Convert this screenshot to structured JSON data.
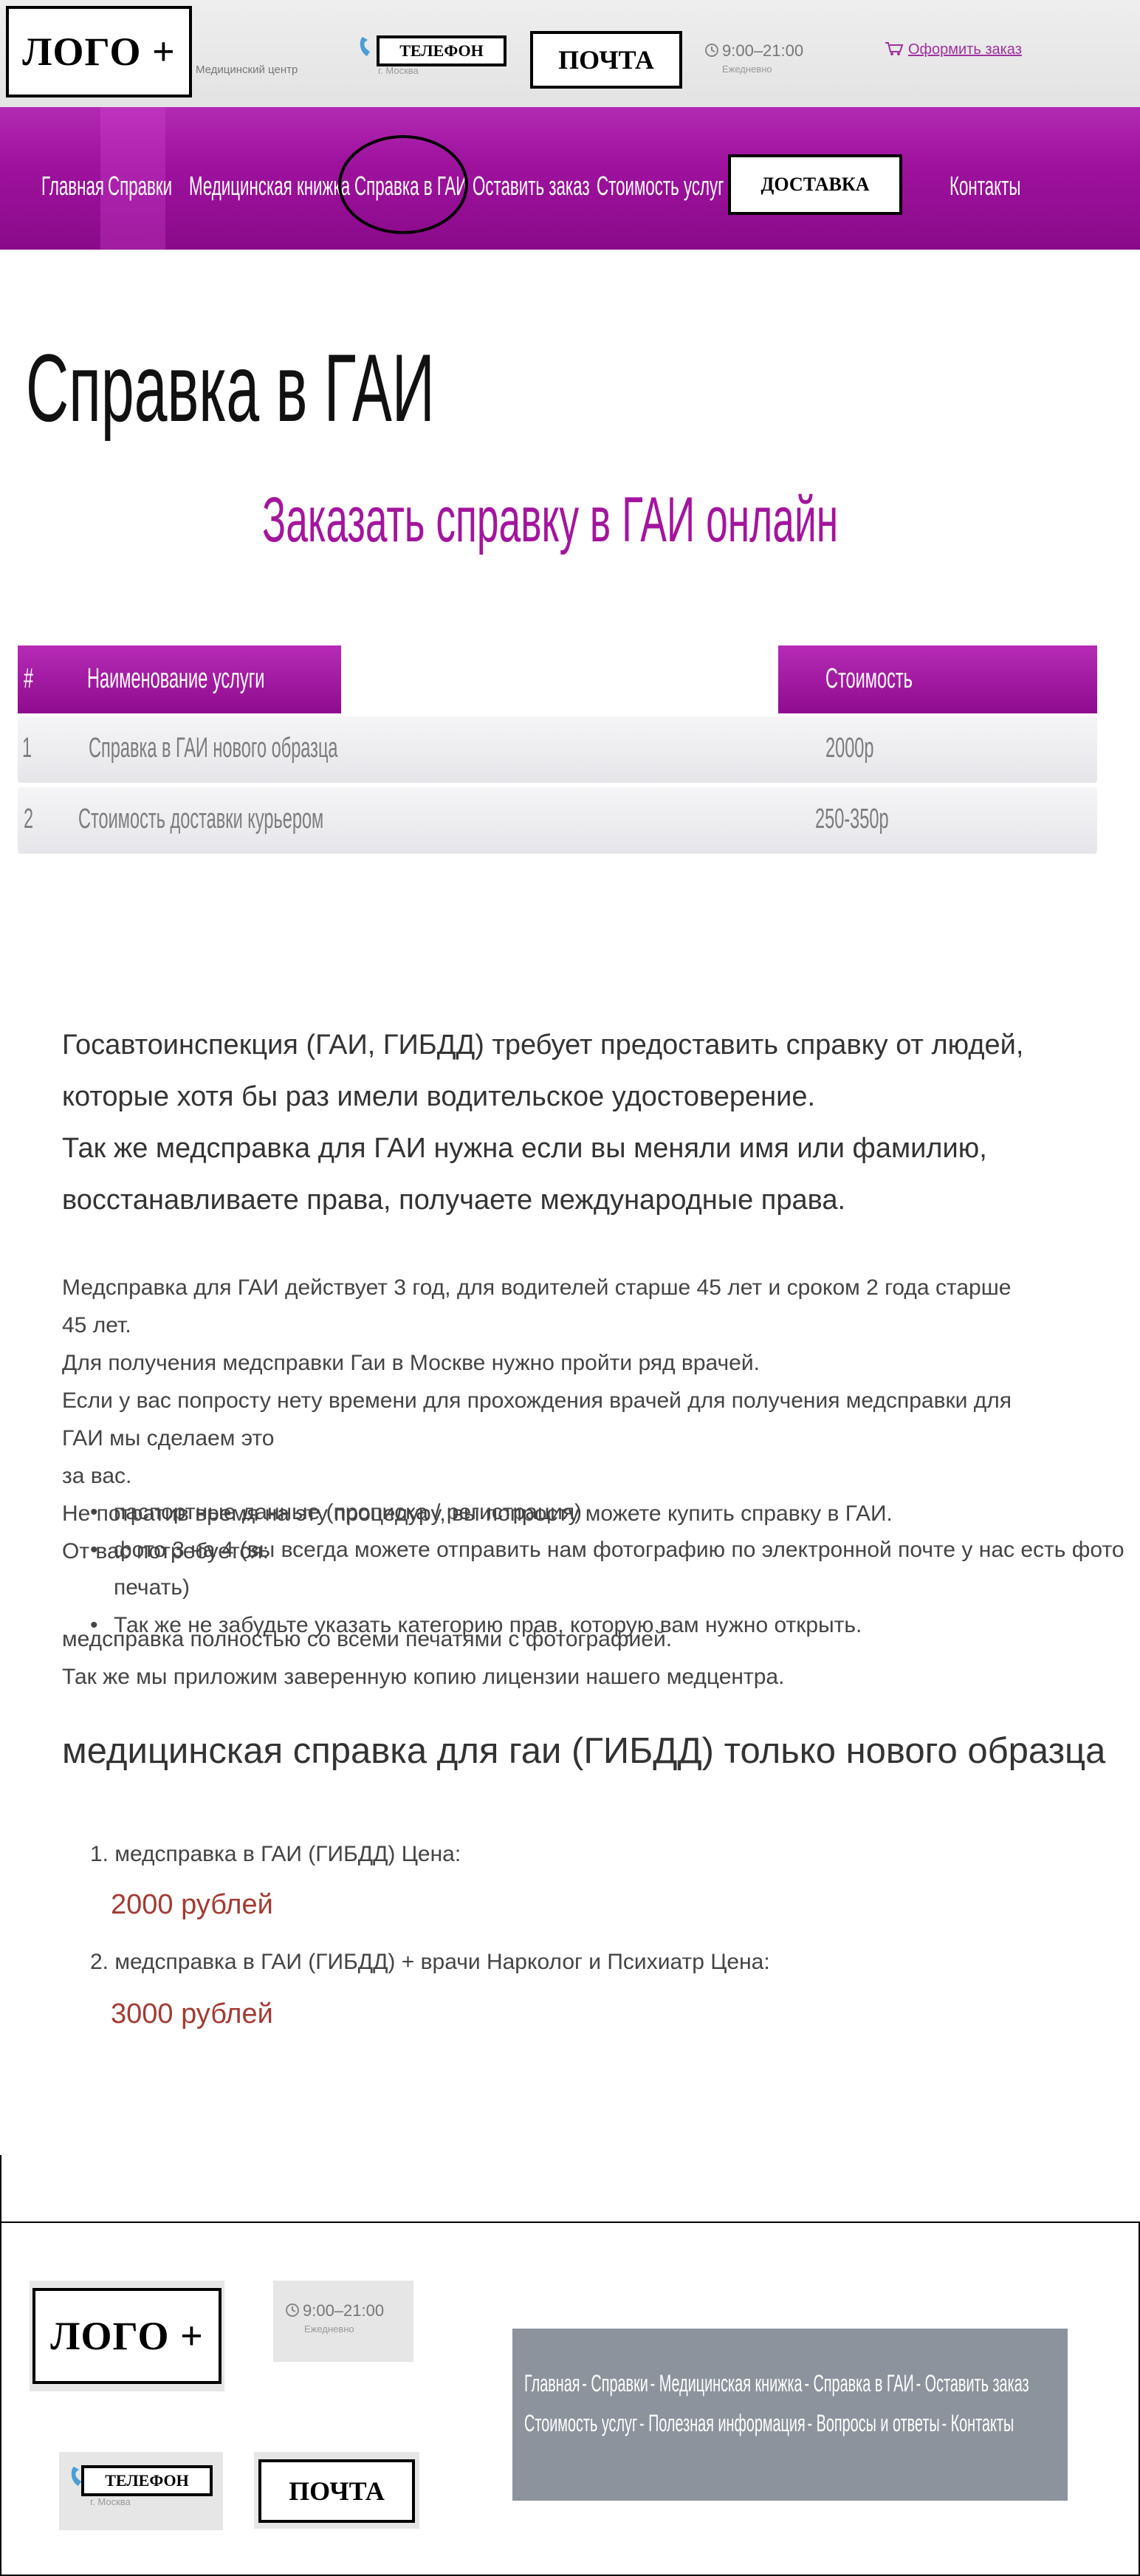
{
  "header": {
    "logo": "ЛОГО +",
    "tagline": "Медицинский центр",
    "phone": "ТЕЛЕФОН",
    "city": "г. Москва",
    "email": "ПОЧТА",
    "hours": "9:00–21:00",
    "days": "Ежедневно",
    "order_link": "Оформить заказ"
  },
  "nav": {
    "items": [
      "Главная",
      "Справки",
      "Медицинская книжка",
      "Справка в ГАИ",
      "Оставить заказ",
      "Стоимость услуг",
      "ДОСТАВКА",
      "Контакты"
    ]
  },
  "main": {
    "title": "Справка в ГАИ",
    "subtitle": "Заказать справку в ГАИ онлайн",
    "table": {
      "headers": [
        "#",
        "Наименование услуги",
        "Стоимость"
      ],
      "rows": [
        {
          "num": "1",
          "name": "Справка в ГАИ нового образца",
          "price": "2000р"
        },
        {
          "num": "2",
          "name": "Стоимость доставки курьером",
          "price": "250-350р"
        }
      ]
    },
    "intro": [
      "Госавтоинспекция (ГАИ, ГИБДД) требует предоставить справку от людей,",
      "которые хотя бы раз имели водительское удостоверение.",
      "Так же медсправка для ГАИ нужна если вы меняли имя или фамилию,",
      "восстанавливаете права, получаете международные права."
    ],
    "paragraphs": [
      "Медсправка для ГАИ действует 3 год, для водителей старше 45 лет и сроком 2 года старше 45 лет.",
      "Для получения медсправки Гаи в Москве нужно пройти ряд врачей.",
      "Если у вас попросту нету времени для прохождения врачей для получения медсправки для ГАИ мы сделаем это",
      "за вас.",
      "Не потратив время на эту процедуру, вы попросту можете купить справку в ГАИ.",
      "От вас потребуется:"
    ],
    "bullets": [
      "паспортные данные (прописка / регистрация)",
      "фото 3 на 4 (вы всегда можете отправить нам фотографию по электронной почте у нас есть фото печать)",
      "Так же не забудьте указать категорию прав, которую вам нужно открыть."
    ],
    "closing": [
      "медсправка полностью со всеми печатями с фотографией.",
      "Так же мы приложим заверенную копию лицензии нашего медцентра."
    ],
    "h2": "медицинская справка для гаи (ГИБДД) только нового образца",
    "prices": [
      {
        "label": "1. медсправка в ГАИ (ГИБДД) Цена:",
        "value": "2000 рублей"
      },
      {
        "label": "2. медсправка в ГАИ (ГИБДД) + врачи Нарколог и Психиатр Цена:",
        "value": "3000 рублей"
      }
    ]
  },
  "footer": {
    "logo": "ЛОГО +",
    "hours": "9:00–21:00",
    "days": "Ежедневно",
    "phone": "ТЕЛЕФОН",
    "city": "г. Москва",
    "email": "ПОЧТА",
    "links_row1": [
      "Главная",
      "Справки",
      "Медицинская книжка",
      "Справка в ГАИ",
      "Оставить заказ"
    ],
    "links_row2": [
      "Стоимость услуг",
      "Полезная информация",
      "Вопросы и ответы",
      "Контакты"
    ],
    "separator": "-"
  },
  "colors": {
    "brand_purple": "#9e129e",
    "price_red": "#a33b33",
    "footer_nav_gray": "#8c939c"
  }
}
